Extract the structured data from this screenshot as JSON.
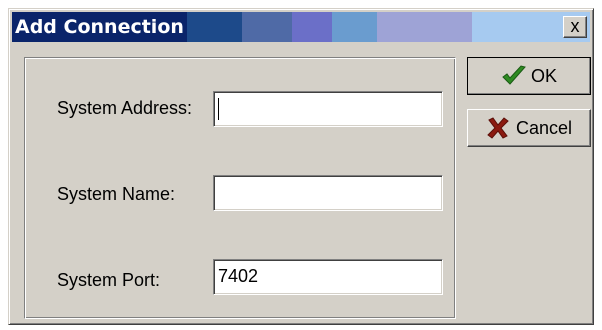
{
  "window": {
    "title": "Add Connection",
    "close_glyph": "x",
    "title_gradient": [
      "#0a246a",
      "#0a246a",
      "#3a6ea5",
      "#5a7ab0",
      "#6b6fc8",
      "#9a96cc",
      "#a6caf0"
    ]
  },
  "form": {
    "system_address": {
      "label": "System Address:",
      "value": ""
    },
    "system_name": {
      "label": "System Name:",
      "value": ""
    },
    "system_port": {
      "label": "System Port:",
      "value": "7402"
    }
  },
  "buttons": {
    "ok": {
      "label": "OK",
      "icon": "checkmark-icon",
      "color": "#2e8b22"
    },
    "cancel": {
      "label": "Cancel",
      "icon": "cross-icon",
      "color": "#8b1a10"
    }
  }
}
